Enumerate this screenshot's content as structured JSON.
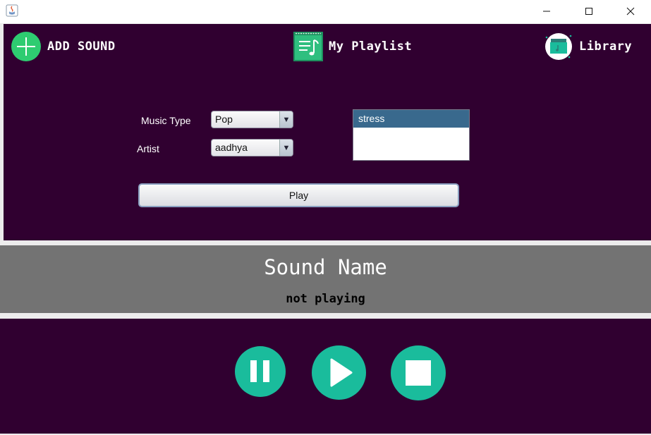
{
  "nav": {
    "add_sound": "ADD SOUND",
    "my_playlist": "My Playlist",
    "library": "Library"
  },
  "form": {
    "music_type_label": "Music Type",
    "music_type_value": "Pop",
    "artist_label": "Artist",
    "artist_value": "aadhya",
    "play_label": "Play"
  },
  "list": {
    "items": [
      "stress"
    ],
    "selected": "stress"
  },
  "now_playing": {
    "title": "Sound Name",
    "status": "not playing"
  },
  "controls": {
    "icons": [
      "pause-icon",
      "play-icon",
      "stop-icon"
    ]
  },
  "colors": {
    "panel_bg": "#300030",
    "accent": "#1abc9c",
    "mid_panel": "#737373",
    "list_selected": "#39698d"
  }
}
